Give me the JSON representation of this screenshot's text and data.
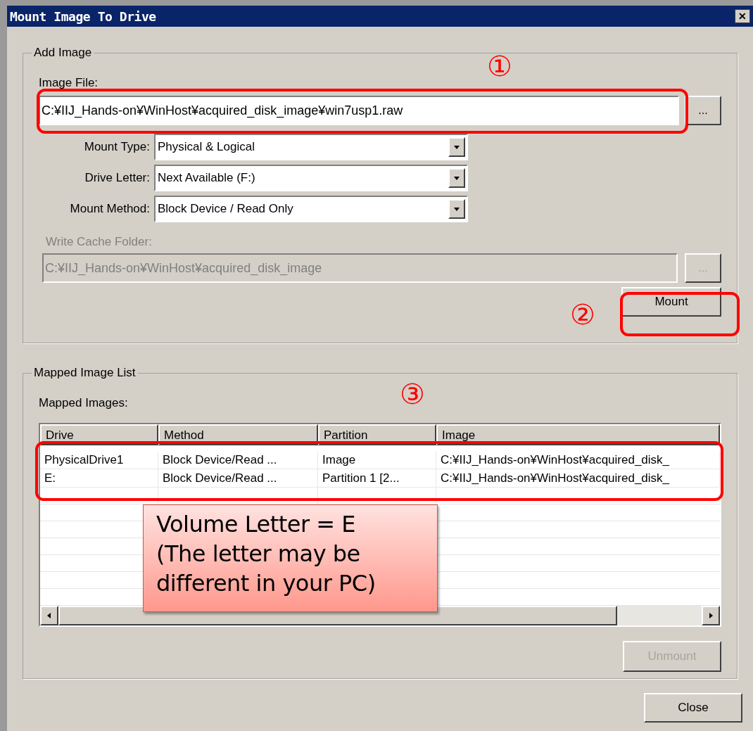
{
  "window": {
    "title": "Mount Image To Drive",
    "close_glyph": "✕"
  },
  "add_image": {
    "legend": "Add Image",
    "image_file": {
      "label": "Image File:",
      "value": "C:¥IIJ_Hands-on¥WinHost¥acquired_disk_image¥win7usp1.raw",
      "browse": "..."
    },
    "selects": [
      {
        "label": "Mount Type:",
        "value": "Physical & Logical"
      },
      {
        "label": "Drive Letter:",
        "value": "Next Available (F:)"
      },
      {
        "label": "Mount Method:",
        "value": "Block Device / Read Only"
      }
    ],
    "write_cache": {
      "label": "Write Cache Folder:",
      "value": "C:¥IIJ_Hands-on¥WinHost¥acquired_disk_image",
      "browse": "...",
      "disabled": true
    },
    "mount_button": {
      "label": "Mount",
      "disabled": false
    }
  },
  "mapped": {
    "legend": "Mapped Image List",
    "label": "Mapped Images:",
    "columns": [
      "Drive",
      "Method",
      "Partition",
      "Image"
    ],
    "rows": [
      [
        "PhysicalDrive1",
        "Block Device/Read ...",
        "Image",
        "C:¥IIJ_Hands-on¥WinHost¥acquired_disk_"
      ],
      [
        "E:",
        "Block Device/Read ...",
        "Partition 1 [2...",
        "C:¥IIJ_Hands-on¥WinHost¥acquired_disk_"
      ]
    ],
    "unmount_button": {
      "label": "Unmount",
      "disabled": true
    }
  },
  "close_button": {
    "label": "Close"
  },
  "annotations": [
    {
      "kind": "number",
      "text": "①"
    },
    {
      "kind": "number",
      "text": "②"
    },
    {
      "kind": "number",
      "text": "③"
    }
  ],
  "callout": {
    "lines": [
      "Volume Letter = E",
      "(The letter may be",
      "different in your PC)"
    ]
  }
}
